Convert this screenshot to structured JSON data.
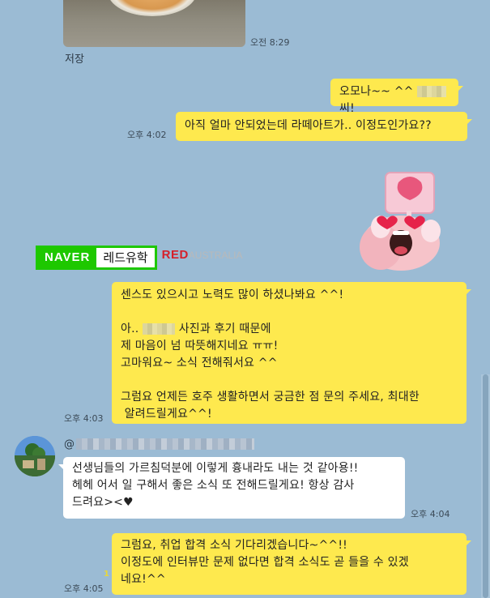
{
  "messages": {
    "photo": {
      "time": "오전 8:29",
      "save_label": "저장"
    },
    "m1": {
      "text_before": "오모나~~ ^^",
      "text_after": "씨!"
    },
    "m2": {
      "text": "아직 얼마 안되었는데 라떼아트가.. 이정도인가요??",
      "time": "오후 4:02"
    },
    "banner": {
      "naver": "NAVER",
      "query": "레드유학",
      "red": "RED",
      "red_faded": "AUSTRALIA"
    },
    "m3": {
      "l1": "센스도 있으시고 노력도 많이 하셨나봐요 ^^!",
      "l2_before": "아..",
      "l2_after": "사진과 후기 때문에",
      "l3": "제 마음이 넘 따뜻해지네요 ㅠㅠ!",
      "l4": "고마워요~ 소식 전해줘서요 ^^",
      "l5": "그럼요 언제든 호주 생활하면서 궁금한 점 문의 주세요, 최대한",
      "l6": " 알려드릴게요^^!",
      "time": "오후 4:03"
    },
    "m4": {
      "sender_prefix": "@",
      "l1": "선생님들의 가르침덕분에 이렇게 흉내라도 내는 것 같아용!!",
      "l2": "헤헤 어서 일 구해서 좋은 소식 또 전해드릴게요! 항상 감사",
      "l3": "드려요><♥",
      "time": "오후 4:04"
    },
    "m5": {
      "l1": "그럼요, 취업 합격 소식 기다리겠습니다~^^!!",
      "l2": "이정도에 인터뷰만 문제 없다면 합격 소식도 곧 들을 수 있겠",
      "l3": "네요!^^",
      "unread": "1",
      "time": "오후 4:05"
    }
  },
  "colors": {
    "outgoing": "#fee94e",
    "incoming": "#ffffff",
    "background": "#9bbbd4",
    "naver_green": "#1ec800"
  }
}
